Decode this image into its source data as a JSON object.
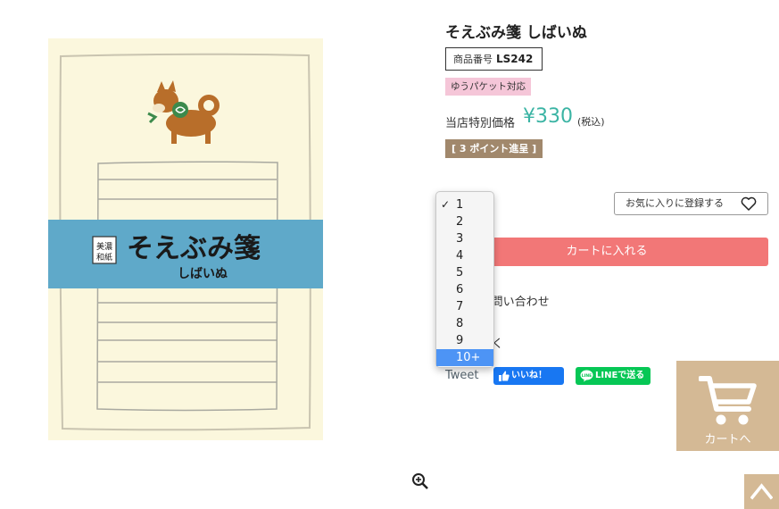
{
  "product": {
    "title": "そえぶみ箋 しばいぬ",
    "sku_label": "商品番号",
    "sku": "LS242",
    "shipping_badge": "ゆうパケット対応",
    "price_label": "当店特別価格",
    "price": "¥330",
    "tax_note": "(税込)",
    "points_badge": "[ 3 ポイント進呈 ]"
  },
  "image": {
    "band_title": "そえぶみ箋",
    "band_subtitle": "しばいぬ",
    "seal_text": "和紙\n美濃",
    "seal_line1": "美濃",
    "seal_line2": "和紙"
  },
  "actions": {
    "favorite": "お気に入りに登録する",
    "add_to_cart": "カートに入れる",
    "inquiry": "いてのお問い合わせ",
    "review": "ューを書く",
    "tweet": "Tweet",
    "fb_like": "いいね！",
    "line_share": "LINEで送る",
    "floating_cart": "カートへ"
  },
  "quantity": {
    "options": [
      "1",
      "2",
      "3",
      "4",
      "5",
      "6",
      "7",
      "8",
      "9",
      "10+"
    ],
    "checked": "1",
    "highlighted": "10+"
  },
  "colors": {
    "price": "#3bb4a4",
    "cart_button": "#f27777",
    "points_badge": "#a1886c",
    "shipping_badge": "#f5c6d8",
    "floating_cart": "#d4b995",
    "band": "#5fa9c9"
  },
  "icons": [
    "zoom-in-icon",
    "heart-icon",
    "facebook-thumb-icon",
    "line-icon",
    "shopping-cart-icon",
    "chevron-up-icon",
    "checkmark-icon"
  ]
}
